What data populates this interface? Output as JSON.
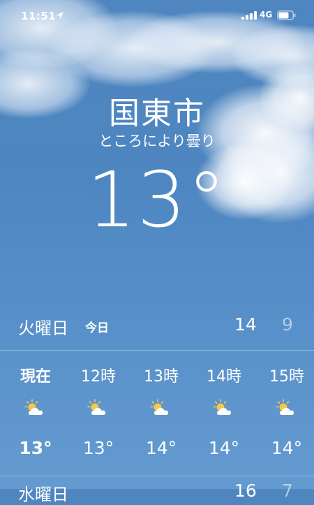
{
  "status_bar": {
    "time": "11:51",
    "network": "4G",
    "icons": [
      "location-arrow-icon",
      "signal-bars-icon",
      "battery-icon"
    ]
  },
  "header": {
    "city": "国東市",
    "condition": "ところにより曇り",
    "temperature": "13°"
  },
  "today": {
    "day": "火曜日",
    "label": "今日",
    "high": "14",
    "low": "9"
  },
  "hourly": [
    {
      "time": "現在",
      "temp": "13°",
      "icon": "partly-cloudy-icon",
      "is_now": true
    },
    {
      "time": "12時",
      "temp": "13°",
      "icon": "partly-cloudy-icon",
      "is_now": false
    },
    {
      "time": "13時",
      "temp": "14°",
      "icon": "partly-cloudy-icon",
      "is_now": false
    },
    {
      "time": "14時",
      "temp": "14°",
      "icon": "partly-cloudy-icon",
      "is_now": false
    },
    {
      "time": "15時",
      "temp": "14°",
      "icon": "partly-cloudy-icon",
      "is_now": false
    }
  ],
  "next_day": {
    "day": "水曜日",
    "high": "16",
    "low": "7"
  },
  "colors": {
    "sky_top": "#4f86c0",
    "sky_bottom": "#5a94cd",
    "sun": "#f7c948",
    "cloud": "#ffffff"
  }
}
